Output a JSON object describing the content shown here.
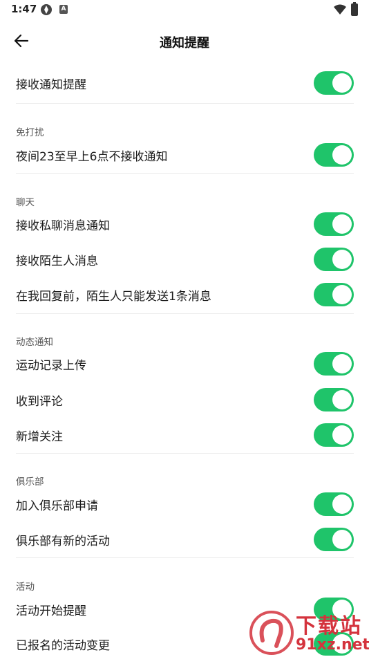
{
  "status_bar": {
    "time": "1:47",
    "badge": "A"
  },
  "header": {
    "title": "通知提醒"
  },
  "colors": {
    "toggle_on": "#1fc46a",
    "watermark": "#d4333d"
  },
  "rows": {
    "receive": "接收通知提醒",
    "night": "夜间23至早上6点不接收通知",
    "private_msg": "接收私聊消息通知",
    "stranger_msg": "接收陌生人消息",
    "stranger_limit": "在我回复前，陌生人只能发送1条消息",
    "sport_upload": "运动记录上传",
    "comment": "收到评论",
    "new_follow": "新增关注",
    "club_join": "加入俱乐部申请",
    "club_activity": "俱乐部有新的活动",
    "activity_start": "活动开始提醒",
    "activity_change": "已报名的活动变更"
  },
  "sections": {
    "dnd": "免打扰",
    "chat": "聊天",
    "feed": "动态通知",
    "club": "俱乐部",
    "activity": "活动"
  },
  "watermark": {
    "text": "下载站",
    "url": "91xz.net"
  }
}
